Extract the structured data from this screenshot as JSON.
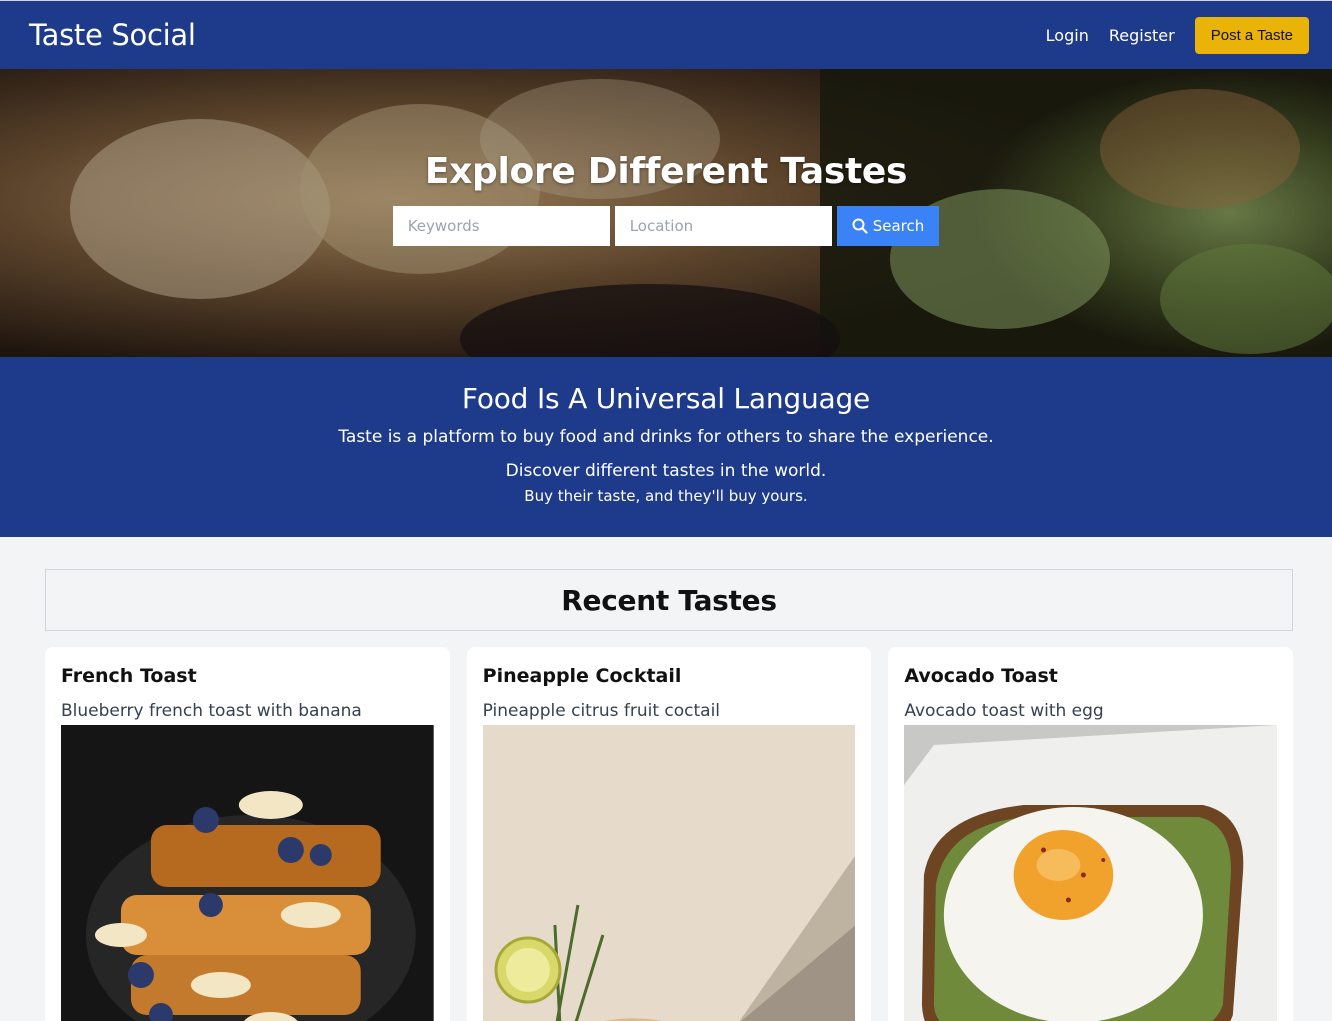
{
  "navbar": {
    "brand": "Taste Social",
    "login": "Login",
    "register": "Register",
    "post_button": "Post a Taste"
  },
  "hero": {
    "title": "Explore Different Tastes",
    "keywords_placeholder": "Keywords",
    "location_placeholder": "Location",
    "search_label": "Search"
  },
  "about": {
    "title": "Food Is A Universal Language",
    "line1": "Taste is a platform to buy food and drinks for others to share the experience.",
    "line2": "Discover different tastes in the world.",
    "line3": "Buy their taste, and they'll buy yours."
  },
  "recent": {
    "title": "Recent Tastes",
    "cards": [
      {
        "title": "French Toast",
        "description": "Blueberry french toast with banana",
        "image": "french-toast-photo"
      },
      {
        "title": "Pineapple Cocktail",
        "description": "Pineapple citrus fruit coctail",
        "image": "cocktail-photo"
      },
      {
        "title": "Avocado Toast",
        "description": "Avocado toast with egg",
        "image": "avocado-toast-photo"
      }
    ]
  },
  "colors": {
    "primary": "#1e3a8a",
    "accent": "#eab308",
    "search_button": "#3b82f6",
    "background": "#f3f4f6"
  }
}
